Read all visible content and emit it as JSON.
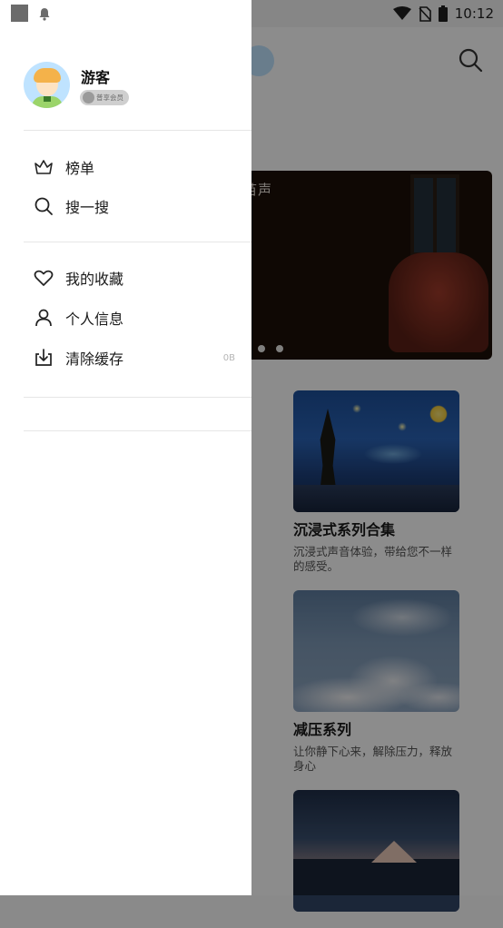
{
  "status_bar": {
    "time": "10:12"
  },
  "background": {
    "banner_title": "蛙鸣声",
    "banner_visible_title": "苗声",
    "cards": [
      {
        "title": "沉浸式系列合集",
        "description": "沉浸式声音体验，带给您不一样的感受。"
      },
      {
        "title": "减压系列",
        "description": "让你静下心来，解除压力，释放身心"
      },
      {
        "title": "",
        "description": ""
      }
    ]
  },
  "drawer": {
    "user": {
      "name": "游客",
      "badge": "普享会员"
    },
    "menu_group_1": [
      {
        "label": "榜单",
        "icon": "crown-icon"
      },
      {
        "label": "搜一搜",
        "icon": "search-icon"
      }
    ],
    "menu_group_2": [
      {
        "label": "我的收藏",
        "icon": "heart-icon"
      },
      {
        "label": "个人信息",
        "icon": "person-icon"
      },
      {
        "label": "清除缓存",
        "icon": "download-icon",
        "value": "0B"
      }
    ]
  }
}
